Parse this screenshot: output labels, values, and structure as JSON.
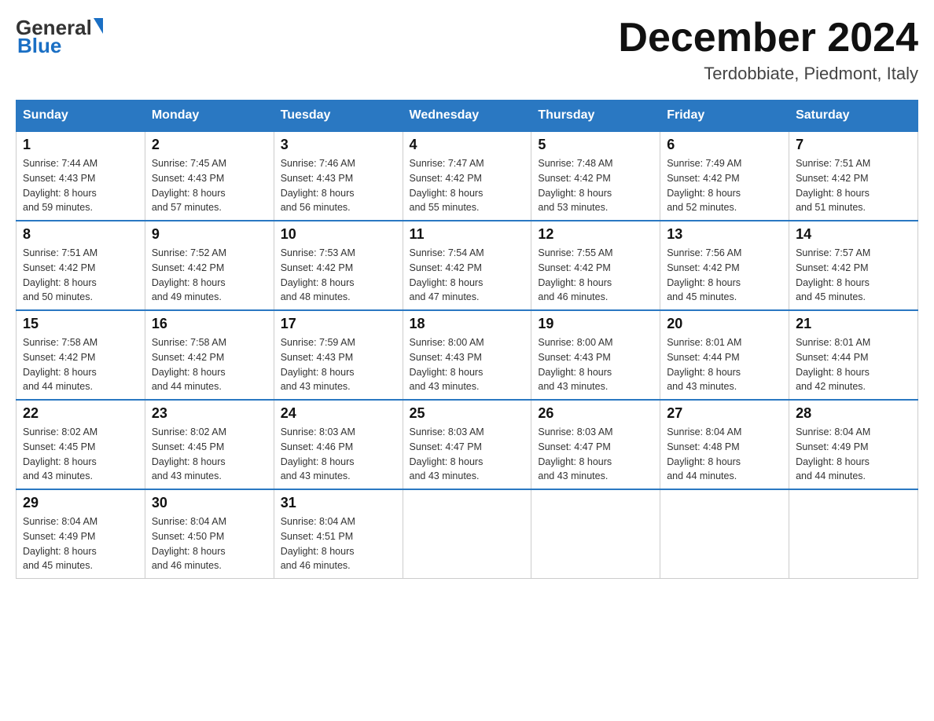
{
  "header": {
    "logo": {
      "general": "General",
      "blue": "Blue"
    },
    "title": "December 2024",
    "location": "Terdobbiate, Piedmont, Italy"
  },
  "days_of_week": [
    "Sunday",
    "Monday",
    "Tuesday",
    "Wednesday",
    "Thursday",
    "Friday",
    "Saturday"
  ],
  "weeks": [
    [
      {
        "day": "1",
        "sunrise": "7:44 AM",
        "sunset": "4:43 PM",
        "daylight": "8 hours and 59 minutes."
      },
      {
        "day": "2",
        "sunrise": "7:45 AM",
        "sunset": "4:43 PM",
        "daylight": "8 hours and 57 minutes."
      },
      {
        "day": "3",
        "sunrise": "7:46 AM",
        "sunset": "4:43 PM",
        "daylight": "8 hours and 56 minutes."
      },
      {
        "day": "4",
        "sunrise": "7:47 AM",
        "sunset": "4:42 PM",
        "daylight": "8 hours and 55 minutes."
      },
      {
        "day": "5",
        "sunrise": "7:48 AM",
        "sunset": "4:42 PM",
        "daylight": "8 hours and 53 minutes."
      },
      {
        "day": "6",
        "sunrise": "7:49 AM",
        "sunset": "4:42 PM",
        "daylight": "8 hours and 52 minutes."
      },
      {
        "day": "7",
        "sunrise": "7:51 AM",
        "sunset": "4:42 PM",
        "daylight": "8 hours and 51 minutes."
      }
    ],
    [
      {
        "day": "8",
        "sunrise": "7:51 AM",
        "sunset": "4:42 PM",
        "daylight": "8 hours and 50 minutes."
      },
      {
        "day": "9",
        "sunrise": "7:52 AM",
        "sunset": "4:42 PM",
        "daylight": "8 hours and 49 minutes."
      },
      {
        "day": "10",
        "sunrise": "7:53 AM",
        "sunset": "4:42 PM",
        "daylight": "8 hours and 48 minutes."
      },
      {
        "day": "11",
        "sunrise": "7:54 AM",
        "sunset": "4:42 PM",
        "daylight": "8 hours and 47 minutes."
      },
      {
        "day": "12",
        "sunrise": "7:55 AM",
        "sunset": "4:42 PM",
        "daylight": "8 hours and 46 minutes."
      },
      {
        "day": "13",
        "sunrise": "7:56 AM",
        "sunset": "4:42 PM",
        "daylight": "8 hours and 45 minutes."
      },
      {
        "day": "14",
        "sunrise": "7:57 AM",
        "sunset": "4:42 PM",
        "daylight": "8 hours and 45 minutes."
      }
    ],
    [
      {
        "day": "15",
        "sunrise": "7:58 AM",
        "sunset": "4:42 PM",
        "daylight": "8 hours and 44 minutes."
      },
      {
        "day": "16",
        "sunrise": "7:58 AM",
        "sunset": "4:42 PM",
        "daylight": "8 hours and 44 minutes."
      },
      {
        "day": "17",
        "sunrise": "7:59 AM",
        "sunset": "4:43 PM",
        "daylight": "8 hours and 43 minutes."
      },
      {
        "day": "18",
        "sunrise": "8:00 AM",
        "sunset": "4:43 PM",
        "daylight": "8 hours and 43 minutes."
      },
      {
        "day": "19",
        "sunrise": "8:00 AM",
        "sunset": "4:43 PM",
        "daylight": "8 hours and 43 minutes."
      },
      {
        "day": "20",
        "sunrise": "8:01 AM",
        "sunset": "4:44 PM",
        "daylight": "8 hours and 43 minutes."
      },
      {
        "day": "21",
        "sunrise": "8:01 AM",
        "sunset": "4:44 PM",
        "daylight": "8 hours and 42 minutes."
      }
    ],
    [
      {
        "day": "22",
        "sunrise": "8:02 AM",
        "sunset": "4:45 PM",
        "daylight": "8 hours and 43 minutes."
      },
      {
        "day": "23",
        "sunrise": "8:02 AM",
        "sunset": "4:45 PM",
        "daylight": "8 hours and 43 minutes."
      },
      {
        "day": "24",
        "sunrise": "8:03 AM",
        "sunset": "4:46 PM",
        "daylight": "8 hours and 43 minutes."
      },
      {
        "day": "25",
        "sunrise": "8:03 AM",
        "sunset": "4:47 PM",
        "daylight": "8 hours and 43 minutes."
      },
      {
        "day": "26",
        "sunrise": "8:03 AM",
        "sunset": "4:47 PM",
        "daylight": "8 hours and 43 minutes."
      },
      {
        "day": "27",
        "sunrise": "8:04 AM",
        "sunset": "4:48 PM",
        "daylight": "8 hours and 44 minutes."
      },
      {
        "day": "28",
        "sunrise": "8:04 AM",
        "sunset": "4:49 PM",
        "daylight": "8 hours and 44 minutes."
      }
    ],
    [
      {
        "day": "29",
        "sunrise": "8:04 AM",
        "sunset": "4:49 PM",
        "daylight": "8 hours and 45 minutes."
      },
      {
        "day": "30",
        "sunrise": "8:04 AM",
        "sunset": "4:50 PM",
        "daylight": "8 hours and 46 minutes."
      },
      {
        "day": "31",
        "sunrise": "8:04 AM",
        "sunset": "4:51 PM",
        "daylight": "8 hours and 46 minutes."
      },
      null,
      null,
      null,
      null
    ]
  ],
  "labels": {
    "sunrise": "Sunrise:",
    "sunset": "Sunset:",
    "daylight": "Daylight:"
  }
}
